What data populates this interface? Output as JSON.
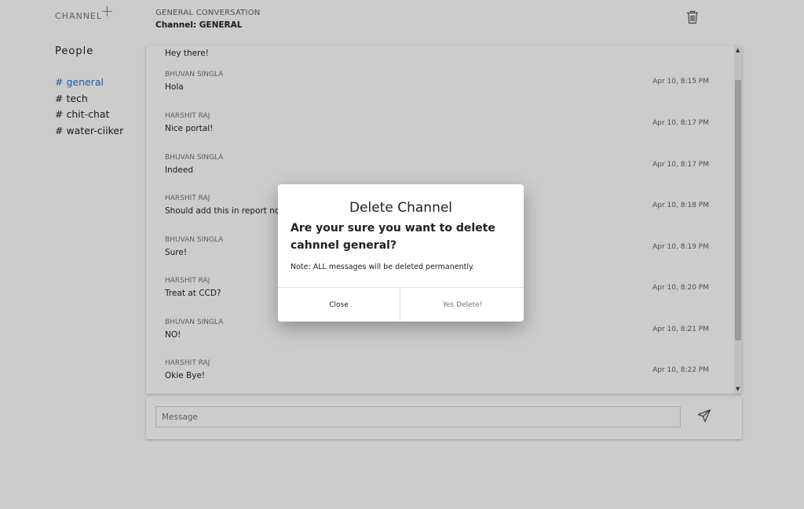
{
  "sidebar": {
    "header": "CHANNEL",
    "add_icon": "plus-icon",
    "people_label": "People",
    "channels": [
      {
        "label": "# general",
        "active": true
      },
      {
        "label": "# tech",
        "active": false
      },
      {
        "label": "# chit-chat",
        "active": false
      },
      {
        "label": "# water-ciiker",
        "active": false
      }
    ]
  },
  "header": {
    "title": "GENERAL CONVERSATION",
    "subtitle": "Channel: GENERAL",
    "delete_icon": "trash-icon"
  },
  "messages": [
    {
      "author": "",
      "text": "Hey there!",
      "time": ""
    },
    {
      "author": "BHUVAN SINGLA",
      "text": "Hola",
      "time": "Apr 10, 8:15 PM"
    },
    {
      "author": "HARSHIT RAJ",
      "text": "Nice portal!",
      "time": "Apr 10, 8:17 PM"
    },
    {
      "author": "BHUVAN SINGLA",
      "text": "Indeed",
      "time": "Apr 10, 8:17 PM"
    },
    {
      "author": "HARSHIT RAJ",
      "text": "Should add this in report now!",
      "time": "Apr 10, 8:18 PM"
    },
    {
      "author": "BHUVAN SINGLA",
      "text": "Sure!",
      "time": "Apr 10, 8:19 PM"
    },
    {
      "author": "HARSHIT RAJ",
      "text": "Treat at CCD?",
      "time": "Apr 10, 8:20 PM"
    },
    {
      "author": "BHUVAN SINGLA",
      "text": "NO!",
      "time": "Apr 10, 8:21 PM"
    },
    {
      "author": "HARSHIT RAJ",
      "text": "Okie Bye!",
      "time": "Apr 10, 8:22 PM"
    }
  ],
  "composer": {
    "placeholder": "Message",
    "send_icon": "send-icon"
  },
  "dialog": {
    "title": "Delete Channel",
    "question": "Are your sure you want to delete cahnnel general?",
    "note": "Note: ALL messages will be deleted permanently.",
    "close_label": "Close",
    "confirm_label": "Yes Delete!"
  },
  "colors": {
    "accent": "#1976d2",
    "overlay": "rgba(0,0,0,0.2)"
  }
}
